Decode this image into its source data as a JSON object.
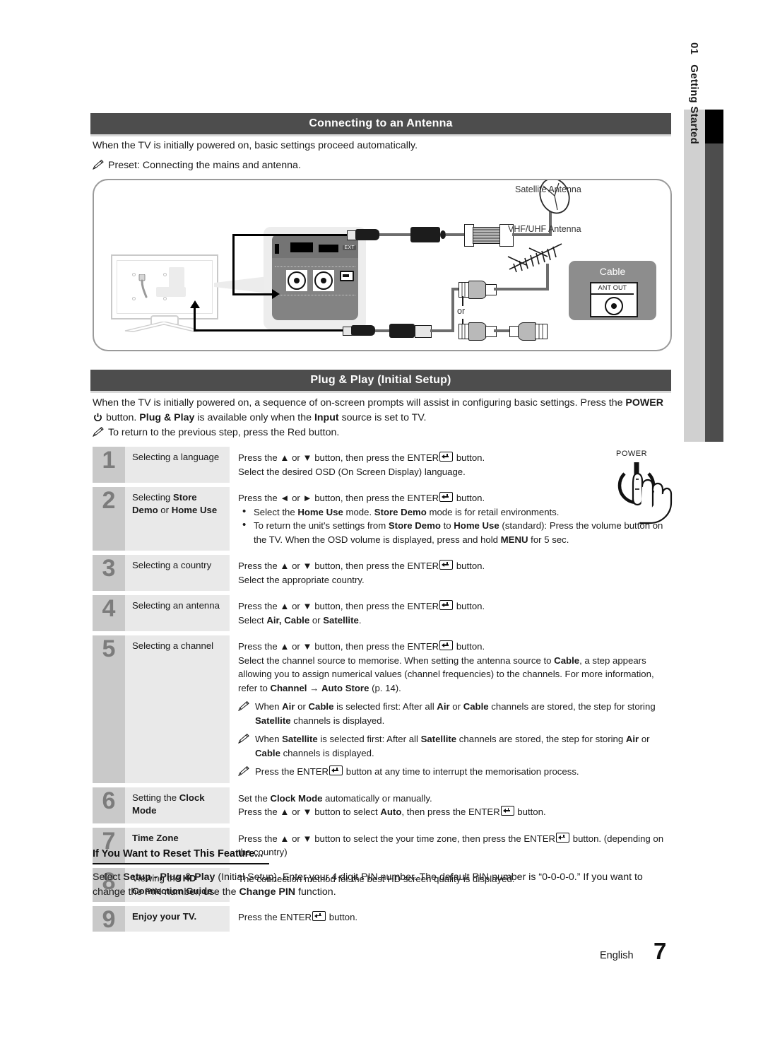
{
  "side_tab": {
    "number": "01",
    "label": "Getting Started"
  },
  "sections": {
    "antenna": {
      "heading": "Connecting to an Antenna",
      "intro": "When the TV is initially powered on, basic settings proceed automatically.",
      "note": "Preset: Connecting the mains and antenna."
    },
    "plugplay": {
      "heading": "Plug & Play (Initial Setup)",
      "intro_1": "When the TV is initially powered on, a sequence of on-screen prompts will assist in configuring basic settings. Press the",
      "intro_power": "POWER",
      "intro_2": "button.",
      "intro_bold_1": "Plug & Play",
      "intro_3": "is available only when the",
      "intro_bold_2": "Input",
      "intro_4": "source is set to TV.",
      "note": "To return to the previous step, press the Red button."
    }
  },
  "diagram": {
    "labels": {
      "satellite_antenna": "Satellite Antenna",
      "vhf_uhf_antenna": "VHF/UHF Antenna",
      "or": "or",
      "cable": "Cable",
      "ant_out": "ANT OUT",
      "ext": "EXT"
    }
  },
  "power_illustration": {
    "label": "POWER"
  },
  "steps": [
    {
      "number": "1",
      "label_parts": [
        {
          "t": "Selecting a language",
          "b": false
        }
      ],
      "lines": [
        [
          {
            "t": "Press the ",
            "b": false
          },
          {
            "t": "▲",
            "b": false
          },
          {
            "t": " or ",
            "b": false
          },
          {
            "t": "▼",
            "b": false
          },
          {
            "t": " button, then press the ENTER",
            "b": false
          },
          {
            "t": "KEY",
            "k": true
          },
          {
            "t": " button.",
            "b": false
          }
        ],
        [
          {
            "t": "Select the desired OSD (On Screen Display) language.",
            "b": false
          }
        ]
      ]
    },
    {
      "number": "2",
      "label_parts": [
        {
          "t": "Selecting ",
          "b": false
        },
        {
          "t": "Store Demo",
          "b": true
        },
        {
          "t": " or ",
          "b": false
        },
        {
          "t": "Home Use",
          "b": true
        }
      ],
      "lines": [
        [
          {
            "t": "Press the ",
            "b": false
          },
          {
            "t": "◄",
            "b": false
          },
          {
            "t": " or ",
            "b": false
          },
          {
            "t": "►",
            "b": false
          },
          {
            "t": " button, then press the ENTER",
            "b": false
          },
          {
            "t": "KEY",
            "k": true
          },
          {
            "t": " button.",
            "b": false
          }
        ]
      ],
      "bullets": [
        [
          {
            "t": "Select the ",
            "b": false
          },
          {
            "t": "Home Use",
            "b": true
          },
          {
            "t": " mode. ",
            "b": false
          },
          {
            "t": "Store Demo",
            "b": true
          },
          {
            "t": " mode is for retail environments.",
            "b": false
          }
        ],
        [
          {
            "t": "To return the unit's settings from ",
            "b": false
          },
          {
            "t": "Store Demo",
            "b": true
          },
          {
            "t": " to ",
            "b": false
          },
          {
            "t": "Home Use",
            "b": true
          },
          {
            "t": " (standard): Press the volume button on the TV. When the OSD volume is displayed, press and hold ",
            "b": false
          },
          {
            "t": "MENU",
            "b": true
          },
          {
            "t": " for 5 sec.",
            "b": false
          }
        ]
      ]
    },
    {
      "number": "3",
      "label_parts": [
        {
          "t": "Selecting a country",
          "b": false
        }
      ],
      "lines": [
        [
          {
            "t": "Press the ",
            "b": false
          },
          {
            "t": "▲",
            "b": false
          },
          {
            "t": " or ",
            "b": false
          },
          {
            "t": "▼",
            "b": false
          },
          {
            "t": " button, then press the ENTER",
            "b": false
          },
          {
            "t": "KEY",
            "k": true
          },
          {
            "t": " button.",
            "b": false
          }
        ],
        [
          {
            "t": "Select the appropriate country.",
            "b": false
          }
        ]
      ]
    },
    {
      "number": "4",
      "label_parts": [
        {
          "t": "Selecting an antenna",
          "b": false
        }
      ],
      "lines": [
        [
          {
            "t": "Press the ",
            "b": false
          },
          {
            "t": "▲",
            "b": false
          },
          {
            "t": " or ",
            "b": false
          },
          {
            "t": "▼",
            "b": false
          },
          {
            "t": " button, then press the ENTER",
            "b": false
          },
          {
            "t": "KEY",
            "k": true
          },
          {
            "t": " button.",
            "b": false
          }
        ],
        [
          {
            "t": "Select ",
            "b": false
          },
          {
            "t": "Air, Cable",
            "b": true
          },
          {
            "t": " or ",
            "b": false
          },
          {
            "t": "Satellite",
            "b": true
          },
          {
            "t": ".",
            "b": false
          }
        ]
      ]
    },
    {
      "number": "5",
      "label_parts": [
        {
          "t": "Selecting a channel",
          "b": false
        }
      ],
      "lines": [
        [
          {
            "t": "Press the ",
            "b": false
          },
          {
            "t": "▲",
            "b": false
          },
          {
            "t": " or ",
            "b": false
          },
          {
            "t": "▼",
            "b": false
          },
          {
            "t": " button, then press the ENTER",
            "b": false
          },
          {
            "t": "KEY",
            "k": true
          },
          {
            "t": " button.",
            "b": false
          }
        ],
        [
          {
            "t": "Select the channel source to memorise. When setting the antenna source to ",
            "b": false
          },
          {
            "t": "Cable",
            "b": true
          },
          {
            "t": ", a step appears allowing you to assign numerical values (channel frequencies) to the channels. For more information, refer to ",
            "b": false
          },
          {
            "t": "Channel →",
            "b": true
          },
          {
            "t": " ",
            "b": false
          },
          {
            "t": "Auto Store",
            "b": true
          },
          {
            "t": " (p. 14).",
            "b": false
          }
        ]
      ],
      "notes": [
        [
          {
            "t": "When ",
            "b": false
          },
          {
            "t": "Air",
            "b": true
          },
          {
            "t": " or ",
            "b": false
          },
          {
            "t": "Cable",
            "b": true
          },
          {
            "t": " is selected first: After all ",
            "b": false
          },
          {
            "t": "Air",
            "b": true
          },
          {
            "t": " or ",
            "b": false
          },
          {
            "t": "Cable",
            "b": true
          },
          {
            "t": " channels are stored, the step for storing ",
            "b": false
          },
          {
            "t": "Satellite",
            "b": true
          },
          {
            "t": " channels is displayed.",
            "b": false
          }
        ],
        [
          {
            "t": "When ",
            "b": false
          },
          {
            "t": "Satellite",
            "b": true
          },
          {
            "t": " is selected first: After all ",
            "b": false
          },
          {
            "t": "Satellite",
            "b": true
          },
          {
            "t": " channels are stored, the step for storing ",
            "b": false
          },
          {
            "t": "Air",
            "b": true
          },
          {
            "t": " or ",
            "b": false
          },
          {
            "t": "Cable",
            "b": true
          },
          {
            "t": " channels is displayed.",
            "b": false
          }
        ],
        [
          {
            "t": "Press the ENTER",
            "b": false
          },
          {
            "t": "KEY",
            "k": true
          },
          {
            "t": " button at any time to interrupt the memorisation process.",
            "b": false
          }
        ]
      ]
    },
    {
      "number": "6",
      "label_parts": [
        {
          "t": "Setting the ",
          "b": false
        },
        {
          "t": "Clock Mode",
          "b": true
        }
      ],
      "lines": [
        [
          {
            "t": "Set the ",
            "b": false
          },
          {
            "t": "Clock Mode",
            "b": true
          },
          {
            "t": " automatically or manually.",
            "b": false
          }
        ],
        [
          {
            "t": "Press the ",
            "b": false
          },
          {
            "t": "▲",
            "b": false
          },
          {
            "t": " or ",
            "b": false
          },
          {
            "t": "▼",
            "b": false
          },
          {
            "t": " button to select ",
            "b": false
          },
          {
            "t": "Auto",
            "b": true
          },
          {
            "t": ", then press the ENTER",
            "b": false
          },
          {
            "t": "KEY",
            "k": true
          },
          {
            "t": " button.",
            "b": false
          }
        ]
      ]
    },
    {
      "number": "7",
      "label_parts": [
        {
          "t": "Time Zone",
          "b": true
        }
      ],
      "lines": [
        [
          {
            "t": "Press the ",
            "b": false
          },
          {
            "t": "▲",
            "b": false
          },
          {
            "t": " or ",
            "b": false
          },
          {
            "t": "▼",
            "b": false
          },
          {
            "t": " button to select the your time zone, then press the ENTER",
            "b": false
          },
          {
            "t": "KEY",
            "k": true
          },
          {
            "t": " button. (depending on the country)",
            "b": false
          }
        ]
      ]
    },
    {
      "number": "8",
      "label_parts": [
        {
          "t": "Viewing the ",
          "b": false
        },
        {
          "t": "HD Connection Guide.",
          "b": true
        }
      ],
      "lines": [
        [
          {
            "t": "The connection method for the best HD screen quality is displayed.",
            "b": false
          }
        ]
      ]
    },
    {
      "number": "9",
      "label_parts": [
        {
          "t": "Enjoy your TV.",
          "b": true
        }
      ],
      "lines": [
        [
          {
            "t": "Press the ENTER",
            "b": false
          },
          {
            "t": "KEY",
            "k": true
          },
          {
            "t": " button.",
            "b": false
          }
        ]
      ]
    }
  ],
  "reset": {
    "title": "If You Want to Reset This Feature...",
    "body_parts": [
      {
        "t": "Select ",
        "b": false
      },
      {
        "t": "Setup - Plug & Play",
        "b": true
      },
      {
        "t": " (Initial Setup). Enter your 4 digit PIN number. The default PIN number is “0-0-0-0.” If you want to change the PIN number, use the ",
        "b": false
      },
      {
        "t": "Change PIN",
        "b": true
      },
      {
        "t": " function.",
        "b": false
      }
    ]
  },
  "footer": {
    "language": "English",
    "page_number": "7"
  },
  "colors": {
    "header_bar": "#4d4d4d",
    "step_number_bg": "#c9c9c9",
    "step_label_bg": "#e9e9e9",
    "side_tab_bg": "#d0d0d0"
  }
}
